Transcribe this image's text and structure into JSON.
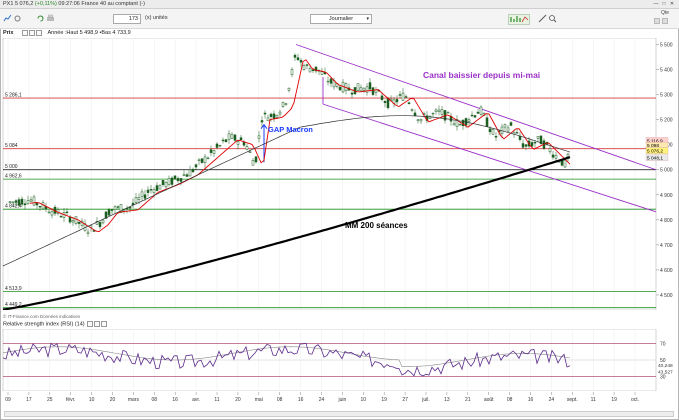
{
  "header": {
    "ticker": "PX1",
    "price": "5 076,2",
    "change": "(+0,11%)",
    "time_source": "09:27:06 France 40 au comptant (-)"
  },
  "toolbar": {
    "units_value": "173",
    "units_label": "(x) unités",
    "period_select": "Journalier",
    "qte_label": "Qte"
  },
  "main_chart": {
    "panel_label": "Prix",
    "ohlc_info": "Année :Haut 5 498,9 •Bas 4 733,9",
    "annotation_canal": "Canal baissier depuis mi-mai",
    "annotation_gap": "GAP Macron",
    "annotation_mm": "MM 200 séances",
    "copyright": "© IT-Finance.com Données indicatives",
    "right_axis_ticks": [
      "5 500",
      "5 400",
      "5 300",
      "5 200",
      "5 100",
      "5 000",
      "4 900",
      "4 800",
      "4 700",
      "4 600",
      "4 500"
    ],
    "level_labels": [
      "5 286,1",
      "5 084",
      "5 000",
      "4 962,6",
      "4 842,4",
      "4 513,9",
      "4 449,2"
    ],
    "price_tags": [
      "5 116,9",
      "5 098",
      "5 076,2",
      "5 048,1"
    ],
    "colors": {
      "price_line": "#e00000",
      "ma200": "#000000",
      "canal": "#9b30c8",
      "gap_text": "#1a3cff",
      "level": "#1a8f1a"
    }
  },
  "rsi_chart": {
    "title": "Relative strength index (RSI) (14)",
    "right_ticks": [
      "70",
      "50",
      "30"
    ],
    "value_labels": [
      "40,248",
      "43,527"
    ]
  },
  "x_axis_labels": [
    "09",
    "17",
    "25",
    "févr.",
    "10",
    "20",
    "mars",
    "08",
    "16",
    "avr.",
    "11",
    "20",
    "mai",
    "08",
    "16",
    "24",
    "juin",
    "10",
    "19",
    "27",
    "juil.",
    "13",
    "21",
    "août",
    "08",
    "16",
    "24",
    "sept.",
    "11",
    "19",
    "oct."
  ]
}
